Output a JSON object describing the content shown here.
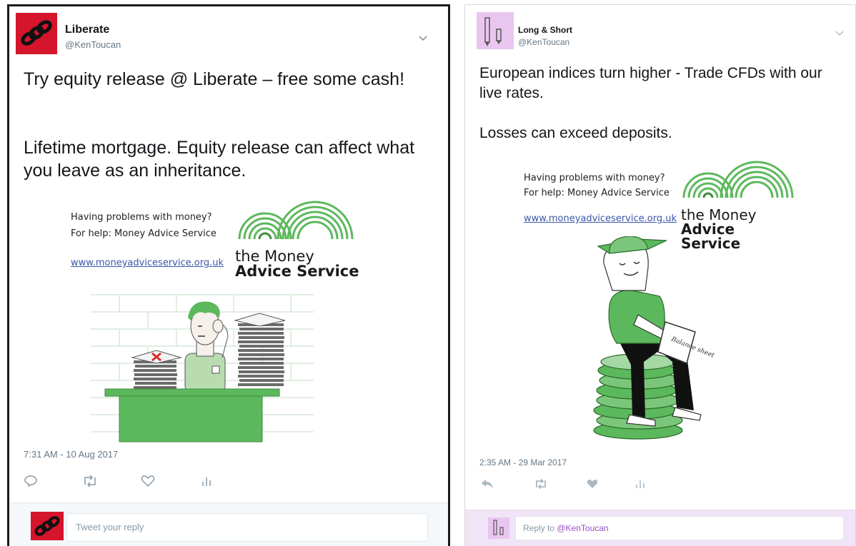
{
  "tweet1": {
    "author": "Liberate",
    "handle": "@KenToucan",
    "text_line1": "Try equity release @ Liberate – free some cash!",
    "text_line2": "Lifetime mortgage. Equity release can affect what you leave as an inheritance.",
    "ad_text": "Having problems with money?\nFor help: Money Advice Service",
    "ad_link": "www.moneyadviceservice.org.uk",
    "brand_line1": "the Money",
    "brand_line2": "Advice Service",
    "timestamp": "7:31 AM - 10 Aug 2017",
    "reply_placeholder": "Tweet your reply",
    "avatar_color": "#d4152b"
  },
  "tweet2": {
    "author": "Long & Short",
    "handle": "@KenToucan",
    "text_line1": "European indices turn higher - Trade CFDs with our live rates.",
    "text_line2": "Losses can exceed deposits.",
    "ad_text": "Having problems with money?\nFor help: Money Advice Service",
    "ad_link": "www.moneyadviceservice.org.uk",
    "brand_line1": "the Money",
    "brand_line2": "Advice Service",
    "timestamp": "2:35 AM - 29 Mar 2017",
    "reply_prefix": "Reply to ",
    "reply_mention": "@KenToucan",
    "avatar_color": "#e8c6f0",
    "book_title": "Balance sheet"
  },
  "icons": {
    "reply": "reply-icon",
    "retweet": "retweet-icon",
    "like": "heart-icon",
    "analytics": "analytics-icon",
    "caret": "chevron-down-icon"
  },
  "colors": {
    "mas_green": "#5cb85c",
    "mas_dark_green": "#3d8b3d",
    "link_blue": "#3b56a8",
    "mention_purple": "#9b4dca"
  }
}
